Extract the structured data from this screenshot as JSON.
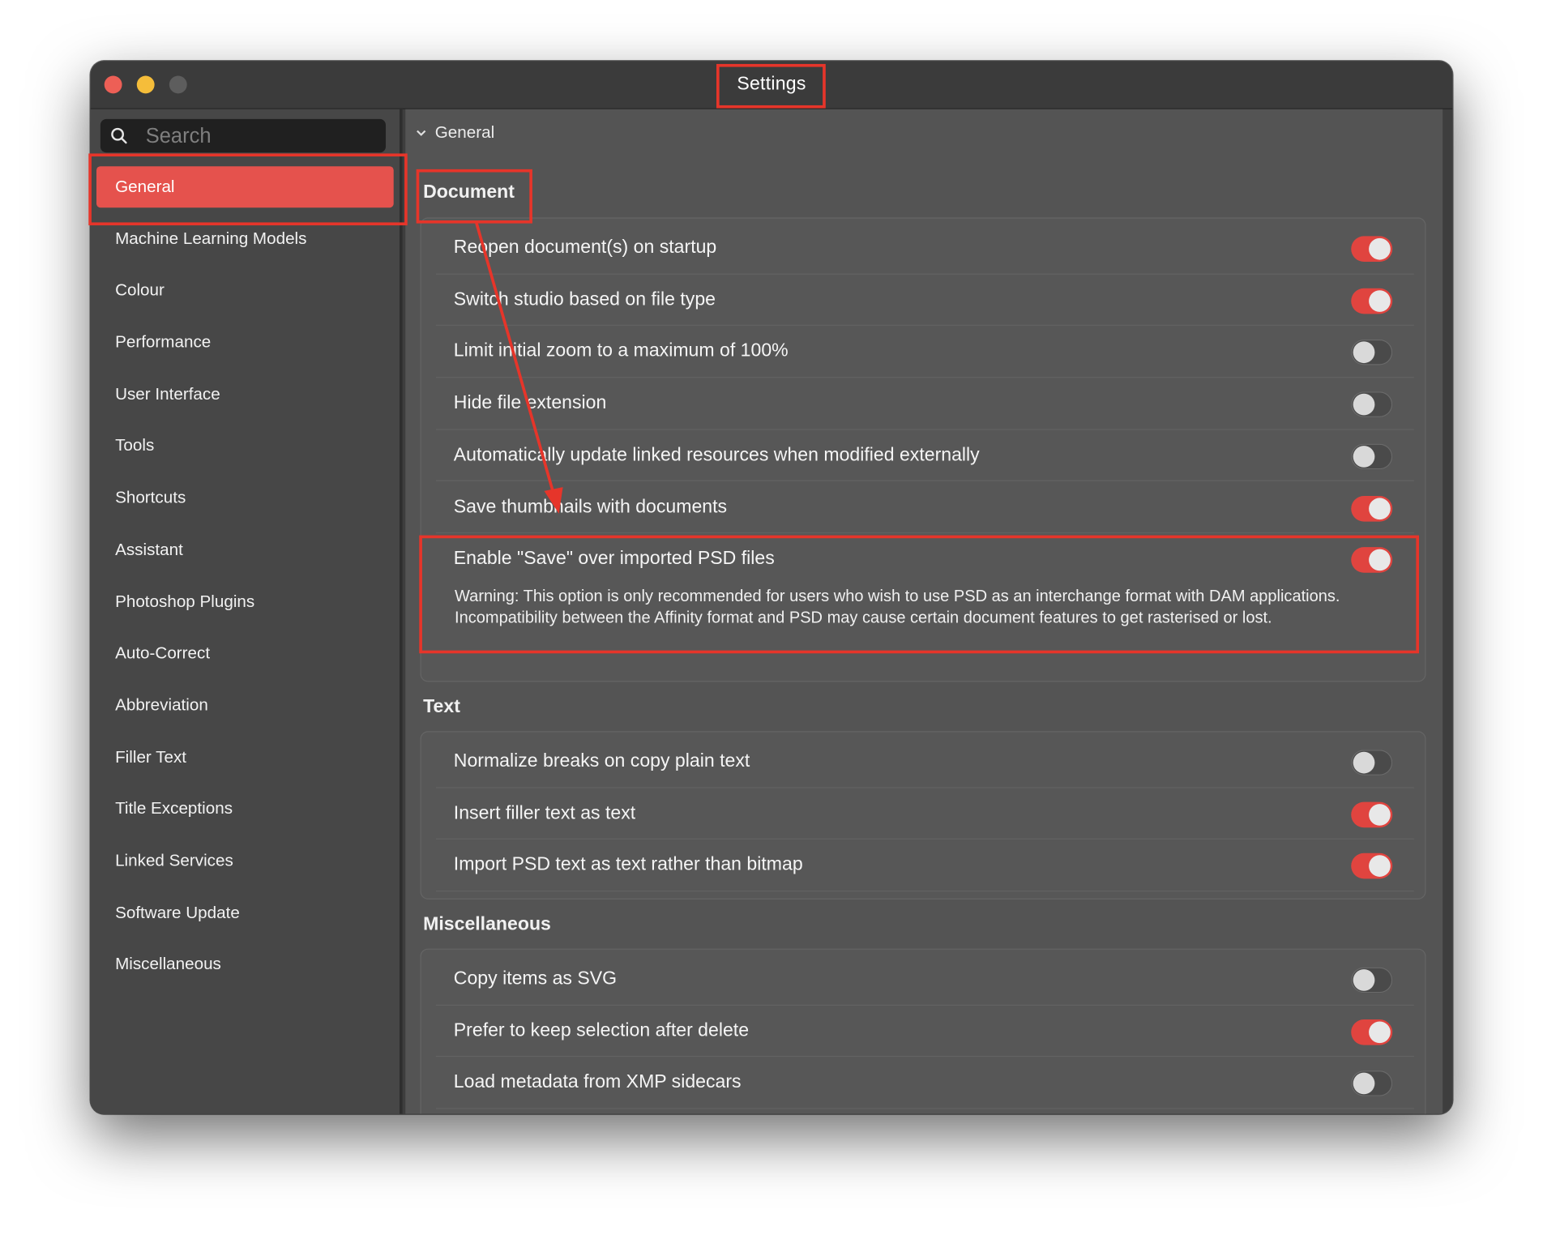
{
  "window": {
    "title": "Settings"
  },
  "sidebar": {
    "search_placeholder": "Search",
    "items": [
      {
        "label": "General",
        "selected": true
      },
      {
        "label": "Machine Learning Models"
      },
      {
        "label": "Colour"
      },
      {
        "label": "Performance"
      },
      {
        "label": "User Interface"
      },
      {
        "label": "Tools"
      },
      {
        "label": "Shortcuts"
      },
      {
        "label": "Assistant"
      },
      {
        "label": "Photoshop Plugins"
      },
      {
        "label": "Auto-Correct"
      },
      {
        "label": "Abbreviation"
      },
      {
        "label": "Filler Text"
      },
      {
        "label": "Title Exceptions"
      },
      {
        "label": "Linked Services"
      },
      {
        "label": "Software Update"
      },
      {
        "label": "Miscellaneous"
      }
    ]
  },
  "content": {
    "breadcrumb": "General",
    "sections": {
      "document": {
        "title": "Document",
        "rows": [
          {
            "label": "Reopen document(s) on startup",
            "on": true
          },
          {
            "label": "Switch studio based on file type",
            "on": true
          },
          {
            "label": "Limit initial zoom to a maximum of 100%",
            "on": false
          },
          {
            "label": "Hide file extension",
            "on": false
          },
          {
            "label": "Automatically update linked resources when modified externally",
            "on": false
          },
          {
            "label": "Save thumbnails with documents",
            "on": true
          },
          {
            "label": "Enable \"Save\" over imported PSD files",
            "on": true
          }
        ],
        "warning_line1": "Warning: This option is only recommended for users who wish to use PSD as an interchange format with DAM applications.",
        "warning_line2": "Incompatibility between the Affinity format and PSD may cause certain document features to get rasterised or lost."
      },
      "text": {
        "title": "Text",
        "rows": [
          {
            "label": "Normalize breaks on copy plain text",
            "on": false
          },
          {
            "label": "Insert filler text as text",
            "on": true
          },
          {
            "label": "Import PSD text as text rather than bitmap",
            "on": true
          }
        ]
      },
      "misc": {
        "title": "Miscellaneous",
        "rows": [
          {
            "label": "Copy items as SVG",
            "on": false
          },
          {
            "label": "Prefer to keep selection after delete",
            "on": true
          },
          {
            "label": "Load metadata from XMP sidecars",
            "on": false
          }
        ]
      }
    }
  },
  "colors": {
    "accent": "#e5524d",
    "toggle_on": "#e0443f",
    "annotation": "#e6352a"
  }
}
